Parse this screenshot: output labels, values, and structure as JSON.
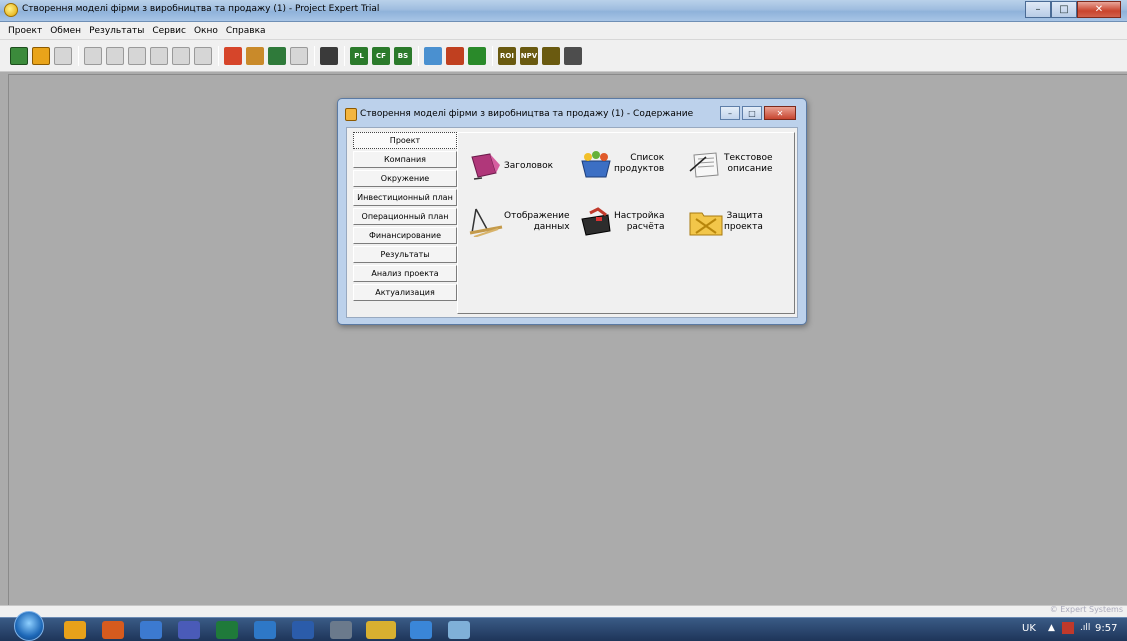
{
  "window": {
    "title": "Створення моделі фірми з виробництва та продажу (1) - Project Expert Trial",
    "minimize": "–",
    "maximize": "□",
    "close": "✕"
  },
  "menu": [
    "Проект",
    "Обмен",
    "Результаты",
    "Сервис",
    "Окно",
    "Справка"
  ],
  "toolbar": {
    "labels": {
      "pl": "PL",
      "cf": "CF",
      "bs": "BS",
      "roi": "ROI",
      "npv": "NPV"
    }
  },
  "child_window": {
    "title": "Створення моделі фірми з виробництва та продажу (1) - Содержание",
    "nav": [
      "Проект",
      "Компания",
      "Окружение",
      "Инвестиционный план",
      "Операционный план",
      "Финансирование",
      "Результаты",
      "Анализ проекта",
      "Актуализация"
    ],
    "active_nav": "Проект",
    "tiles": {
      "title_page": "Заголовок",
      "products": "Список\nпродуктов",
      "text_desc": "Текстовое\nописание",
      "data_display": "Отображение\nданных",
      "calc_settings": "Настройка\nрасчёта",
      "protection": "Защита\nпроекта"
    }
  },
  "statusbar": {
    "watermark": "© Expert Systems"
  },
  "taskbar": {
    "language": "UK",
    "time": "9:57"
  },
  "colors": {
    "workspace": "#ababab",
    "titlebar": "#9fbddf",
    "taskbar": "#1e3559"
  }
}
